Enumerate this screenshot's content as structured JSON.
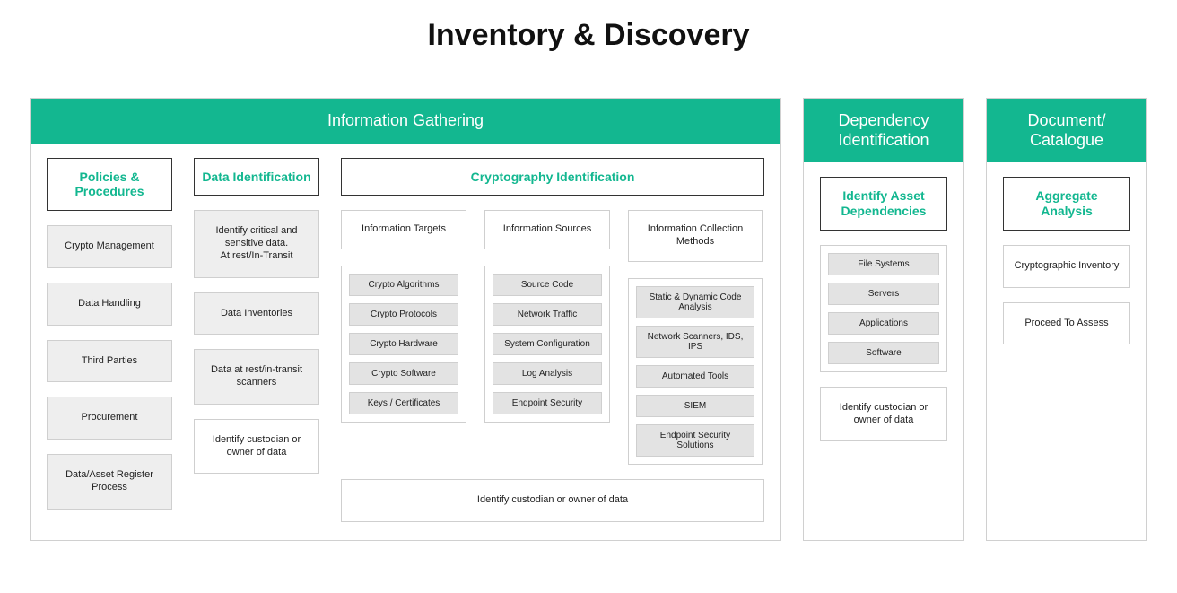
{
  "title": "Inventory & Discovery",
  "panels": {
    "info": {
      "header": "Information Gathering",
      "policies": {
        "heading": "Policies & Procedures",
        "items": [
          "Crypto Management",
          "Data Handling",
          "Third Parties",
          "Procurement",
          "Data/Asset Register Process"
        ]
      },
      "dataIdent": {
        "heading": "Data Identification",
        "items": [
          "Identify critical and sensitive data.\nAt rest/In-Transit",
          "Data Inventories",
          "Data at rest/in-transit scanners",
          "Identify custodian or owner of data"
        ]
      },
      "crypto": {
        "heading": "Cryptography Identification",
        "targets": {
          "header": "Information Targets",
          "items": [
            "Crypto Algorithms",
            "Crypto Protocols",
            "Crypto Hardware",
            "Crypto Software",
            "Keys / Certificates"
          ]
        },
        "sources": {
          "header": "Information Sources",
          "items": [
            "Source Code",
            "Network Traffic",
            "System Configuration",
            "Log Analysis",
            "Endpoint Security"
          ]
        },
        "methods": {
          "header": "Information Collection Methods",
          "items": [
            "Static & Dynamic Code Analysis",
            "Network Scanners, IDS, IPS",
            "Automated Tools",
            "SIEM",
            "Endpoint Security Solutions"
          ]
        },
        "footer": "Identify custodian or owner of data"
      }
    },
    "dep": {
      "header": "Dependency Identification",
      "heading": "Identify Asset Dependencies",
      "items": [
        "File Systems",
        "Servers",
        "Applications",
        "Software"
      ],
      "footer": "Identify custodian or owner of data"
    },
    "doc": {
      "header": "Document/ Catalogue",
      "heading": "Aggregate Analysis",
      "items": [
        "Cryptographic Inventory",
        "Proceed To Assess"
      ]
    }
  }
}
